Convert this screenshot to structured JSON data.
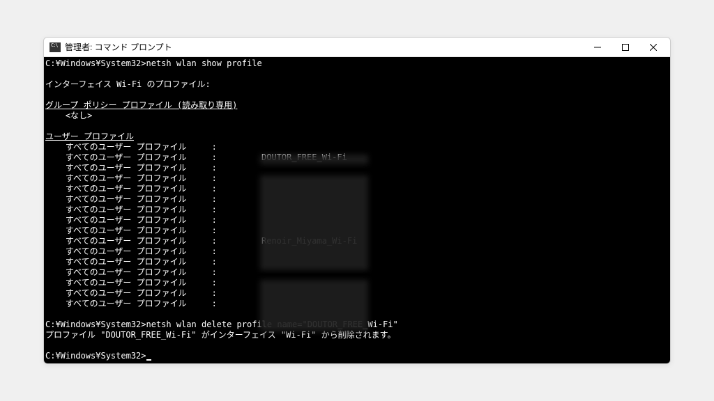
{
  "window": {
    "title": "管理者: コマンド プロンプト"
  },
  "prompt_path": "C:¥Windows¥System32>",
  "cmd1": "netsh wlan show profile",
  "interface_header": "インターフェイス Wi-Fi のプロファイル:",
  "group_policy_header": "グループ ポリシー プロファイル (読み取り専用)",
  "group_policy_dashes": "---------------------------------------------",
  "none_text": "    <なし>",
  "user_profiles_header": "ユーザー プロファイル",
  "user_profiles_dashes": "-------------------",
  "profile_label": "    すべてのユーザー プロファイル",
  "sep": "     : ",
  "profiles": [
    "",
    "DOUTOR_FREE_Wi-Fi",
    "",
    "",
    "",
    "",
    "",
    "",
    "",
    "Renoir_Miyama_Wi-Fi",
    "",
    "",
    "",
    "",
    "",
    ""
  ],
  "cmd2": "netsh wlan delete profile name=\"DOUTOR_FREE_Wi-Fi\"",
  "delete_result": "プロファイル \"DOUTOR_FREE_Wi-Fi\" がインターフェイス \"Wi-Fi\" から削除されます。"
}
